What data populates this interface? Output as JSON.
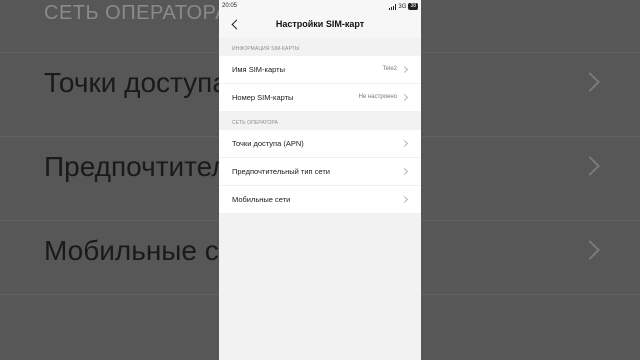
{
  "background": {
    "section_label": "СЕТЬ ОПЕРАТОРА",
    "rows": [
      "Точки доступа",
      "Предпочтител",
      "Мобильные се"
    ]
  },
  "status_bar": {
    "time": "20:05",
    "network": "3G",
    "battery": "38"
  },
  "header": {
    "back_icon": "chevron-left-icon",
    "title": "Настройки SIM-карт"
  },
  "sim_info": {
    "section_label": "ИНФОРМАЦИЯ SIM-КАРТЫ",
    "items": [
      {
        "label": "Имя SIM-карты",
        "value": "Tele2"
      },
      {
        "label": "Номер SIM-карты",
        "value": "Не настроено"
      }
    ]
  },
  "operator_network": {
    "section_label": "СЕТЬ ОПЕРАТОРА",
    "items": [
      {
        "label": "Точки доступа (APN)"
      },
      {
        "label": "Предпочтительный тип сети"
      },
      {
        "label": "Мобильные сети"
      }
    ]
  },
  "colors": {
    "screen_background": "#f2f2f2",
    "list_background": "#ffffff",
    "section_label": "#8d8d8d",
    "outer_background": "#575757"
  }
}
